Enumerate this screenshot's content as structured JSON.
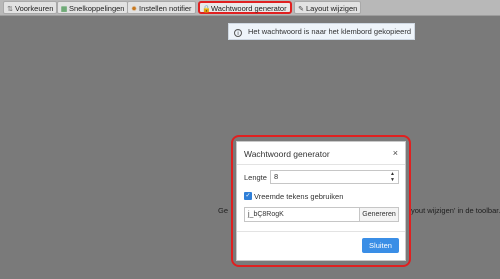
{
  "toolbar": {
    "items": [
      {
        "label": "Voorkeuren",
        "icon": "sliders-icon",
        "glyph": "⇅",
        "color": "#666666"
      },
      {
        "label": "Snelkoppelingen",
        "icon": "grid-icon",
        "glyph": "▦",
        "color": "#2e8b3a"
      },
      {
        "label": "Instellen notifier",
        "icon": "gear-icon",
        "glyph": "✹",
        "color": "#c8781e"
      },
      {
        "label": "Wachtwoord generator",
        "icon": "lock-icon",
        "glyph": "🔒",
        "color": "#c89a1e"
      },
      {
        "label": "Layout wijzigen",
        "icon": "edit-icon",
        "glyph": "✎",
        "color": "#444444"
      }
    ],
    "active_index": 3,
    "highlight_color": "#e02020"
  },
  "toast": {
    "icon": "info-icon",
    "glyph": "i",
    "text": "Het wachtwoord is naar het klembord gekopieerd"
  },
  "background": {
    "text_left": "Ge",
    "text_right": "yout wijzigen' in de toolbar."
  },
  "modal": {
    "title": "Wachtwoord generator",
    "close_glyph": "×",
    "length_label": "Lengte",
    "length_value": "8",
    "spin_glyph": "▲▼",
    "checkbox_checked": true,
    "checkbox_glyph": "✓",
    "checkbox_label": "Vreemde tekens gebruiken",
    "password": "j_bÇ8RogK",
    "generate_label": "Genereren",
    "close_label": "Sluiten",
    "accent": "#3a8ee6"
  }
}
